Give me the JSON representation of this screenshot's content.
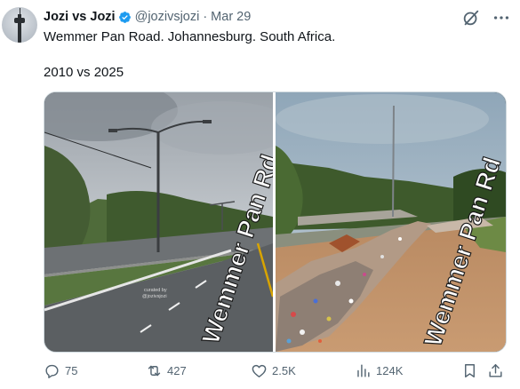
{
  "author": {
    "display_name": "Jozi vs Jozi",
    "handle": "@jozivsjozi",
    "separator": "·",
    "date": "Mar 29"
  },
  "tweet": {
    "line1": "Wemmer Pan Road. Johannesburg. South Africa.",
    "line2": "2010 vs 2025"
  },
  "media": {
    "left_sign": "Wemmer Pan Rd",
    "right_sign": "Wemmer Pan Rd",
    "watermark_line1": "curated by",
    "watermark_line2": "@jozivsjozi"
  },
  "actions": {
    "replies": "75",
    "reposts": "427",
    "likes": "2.5K",
    "views": "124K"
  },
  "colors": {
    "text_primary": "#0f1419",
    "text_secondary": "#536471",
    "verified_blue": "#1d9bf0"
  }
}
